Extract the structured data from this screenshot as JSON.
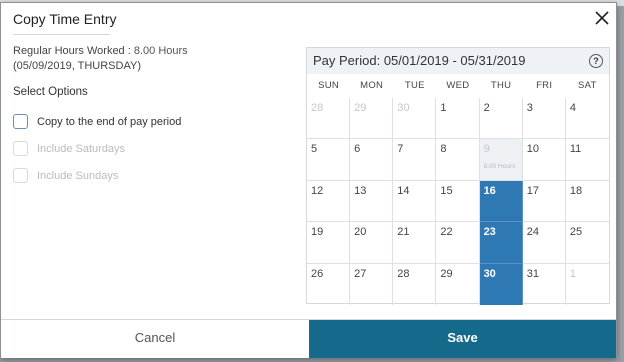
{
  "dialog": {
    "title": "Copy Time Entry",
    "regular_hours_label": "Regular Hours Worked :",
    "regular_hours_value": "8.00 Hours",
    "date_line": "(05/09/2019, THURSDAY)",
    "select_options_heading": "Select Options",
    "options": [
      {
        "label": "Copy to the end of pay period",
        "checked": false,
        "enabled": true
      },
      {
        "label": "Include Saturdays",
        "checked": false,
        "enabled": false
      },
      {
        "label": "Include Sundays",
        "checked": false,
        "enabled": false
      }
    ]
  },
  "calendar": {
    "title": "Pay Period: 05/01/2019 - 05/31/2019",
    "help": "?",
    "weekdays": [
      "SUN",
      "MON",
      "TUE",
      "WED",
      "THU",
      "FRI",
      "SAT"
    ],
    "weeks": [
      [
        {
          "d": "28",
          "s": "muted"
        },
        {
          "d": "29",
          "s": "muted"
        },
        {
          "d": "30",
          "s": "muted"
        },
        {
          "d": "1"
        },
        {
          "d": "2"
        },
        {
          "d": "3"
        },
        {
          "d": "4"
        }
      ],
      [
        {
          "d": "5"
        },
        {
          "d": "6"
        },
        {
          "d": "7"
        },
        {
          "d": "8"
        },
        {
          "d": "9",
          "s": "source",
          "sub": "8.00 Hours"
        },
        {
          "d": "10"
        },
        {
          "d": "11"
        }
      ],
      [
        {
          "d": "12"
        },
        {
          "d": "13"
        },
        {
          "d": "14"
        },
        {
          "d": "15"
        },
        {
          "d": "16",
          "s": "selected"
        },
        {
          "d": "17"
        },
        {
          "d": "18"
        }
      ],
      [
        {
          "d": "19"
        },
        {
          "d": "20"
        },
        {
          "d": "21"
        },
        {
          "d": "22"
        },
        {
          "d": "23",
          "s": "selected"
        },
        {
          "d": "24"
        },
        {
          "d": "25"
        }
      ],
      [
        {
          "d": "26"
        },
        {
          "d": "27"
        },
        {
          "d": "28"
        },
        {
          "d": "29"
        },
        {
          "d": "30",
          "s": "selected"
        },
        {
          "d": "31"
        },
        {
          "d": "1",
          "s": "muted"
        }
      ]
    ],
    "colors": {
      "selected": "#2e78b4",
      "header_bg": "#eef2f6"
    }
  },
  "footer": {
    "cancel_label": "Cancel",
    "save_label": "Save",
    "save_color": "#156a8c"
  }
}
